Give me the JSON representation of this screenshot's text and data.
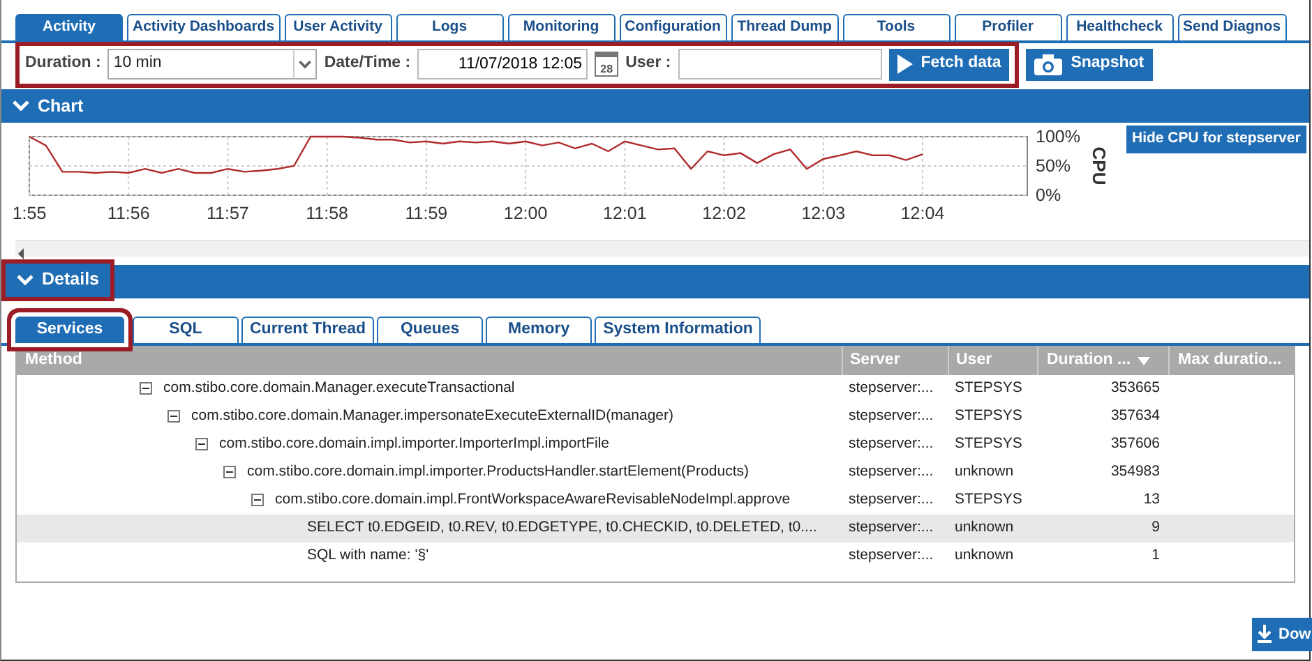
{
  "tabs": [
    {
      "label": "Activity",
      "selected": true
    },
    {
      "label": "Activity Dashboards",
      "selected": false
    },
    {
      "label": "User Activity",
      "selected": false
    },
    {
      "label": "Logs",
      "selected": false
    },
    {
      "label": "Monitoring",
      "selected": false
    },
    {
      "label": "Configuration",
      "selected": false
    },
    {
      "label": "Thread Dump",
      "selected": false
    },
    {
      "label": "Tools",
      "selected": false
    },
    {
      "label": "Profiler",
      "selected": false
    },
    {
      "label": "Healthcheck",
      "selected": false
    },
    {
      "label": "Send Diagnos",
      "selected": false
    }
  ],
  "filters": {
    "duration_label": "Duration :",
    "duration_value": "10 min",
    "datetime_label": "Date/Time :",
    "datetime_value": "11/07/2018 12:05",
    "calendar_day": "28",
    "user_label": "User :",
    "fetch_button": "Fetch data",
    "snapshot_button": "Snapshot"
  },
  "chart_section": {
    "title": "Chart",
    "expanded": true,
    "hide_button": "Hide CPU for stepserver",
    "chart_data": {
      "type": "line",
      "ylabel": "CPU",
      "categories": [
        "1:55",
        null,
        null,
        null,
        null,
        null,
        "11:56",
        null,
        null,
        null,
        null,
        null,
        "11:57",
        null,
        null,
        null,
        null,
        null,
        "11:58",
        null,
        null,
        null,
        null,
        null,
        "11:59",
        null,
        null,
        null,
        null,
        null,
        "12:00",
        null,
        null,
        null,
        null,
        null,
        "12:01",
        null,
        null,
        null,
        null,
        null,
        "12:02",
        null,
        null,
        null,
        null,
        null,
        "12:03",
        null,
        null,
        null,
        null,
        null,
        "12:04"
      ],
      "series": [
        {
          "color": "#b02a2a",
          "values": [
            100,
            85,
            40,
            40,
            38,
            40,
            38,
            45,
            38,
            45,
            38,
            38,
            45,
            40,
            42,
            45,
            50,
            100,
            100,
            100,
            98,
            95,
            95,
            90,
            92,
            88,
            92,
            90,
            92,
            88,
            92,
            85,
            90,
            80,
            88,
            75,
            92,
            85,
            78,
            80,
            45,
            75,
            68,
            72,
            55,
            70,
            78,
            45,
            62,
            68,
            75,
            68,
            68,
            60,
            70
          ]
        }
      ],
      "ylim": [
        0,
        100
      ],
      "grid": true,
      "yticks": [
        {
          "value": 0,
          "label": "0%"
        },
        {
          "value": 50,
          "label": "50%"
        },
        {
          "value": 100,
          "label": "100%"
        }
      ]
    }
  },
  "details_section": {
    "title": "Details",
    "expanded": true
  },
  "subtabs": [
    {
      "label": "Services",
      "selected": true
    },
    {
      "label": "SQL",
      "selected": false
    },
    {
      "label": "Current Thread",
      "selected": false
    },
    {
      "label": "Queues",
      "selected": false
    },
    {
      "label": "Memory",
      "selected": false
    },
    {
      "label": "System Information",
      "selected": false
    }
  ],
  "table": {
    "columns": [
      {
        "label": "Method",
        "sorted": false
      },
      {
        "label": "Server",
        "sorted": false
      },
      {
        "label": "User",
        "sorted": false
      },
      {
        "label": "Duration ...",
        "sorted": true
      },
      {
        "label": "Max duratio...",
        "sorted": false
      }
    ],
    "rows": [
      {
        "method": "com.stibo.core.domain.Manager.executeTransactional",
        "server": "stepserver:...",
        "user": "STEPSYS",
        "duration": "353665",
        "expanded": true,
        "selected": false,
        "children": [
          {
            "method": "com.stibo.core.domain.Manager.impersonateExecuteExternalID(manager)",
            "server": "stepserver:...",
            "user": "STEPSYS",
            "duration": "357634",
            "expanded": true,
            "selected": false,
            "children": [
              {
                "method": "com.stibo.core.domain.impl.importer.ImporterImpl.importFile",
                "server": "stepserver:...",
                "user": "STEPSYS",
                "duration": "357606",
                "expanded": true,
                "selected": false,
                "children": [
                  {
                    "method": "com.stibo.core.domain.impl.importer.ProductsHandler.startElement(Products)",
                    "server": "stepserver:...",
                    "user": "unknown",
                    "duration": "354983",
                    "expanded": true,
                    "selected": false,
                    "children": [
                      {
                        "method": "com.stibo.core.domain.impl.FrontWorkspaceAwareRevisableNodeImpl.approve",
                        "server": "stepserver:...",
                        "user": "STEPSYS",
                        "duration": "13",
                        "expanded": true,
                        "selected": false,
                        "children": [
                          {
                            "method": "SELECT t0.EDGEID, t0.REV, t0.EDGETYPE, t0.CHECKID, t0.DELETED, t0....",
                            "server": "stepserver:...",
                            "user": "unknown",
                            "duration": "9",
                            "selected": true
                          },
                          {
                            "method": "SQL with name: '§'",
                            "server": "stepserver:...",
                            "user": "unknown",
                            "duration": "1",
                            "selected": false
                          }
                        ]
                      }
                    ]
                  }
                ]
              }
            ]
          }
        ]
      }
    ]
  },
  "download_button": "Dow"
}
